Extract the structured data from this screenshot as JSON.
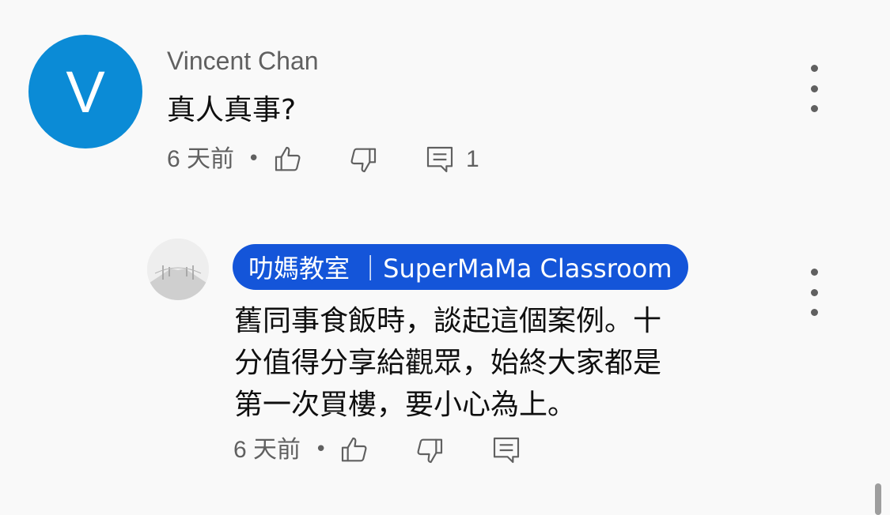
{
  "comment": {
    "author": "Vincent Chan",
    "avatar_letter": "V",
    "text": "真人真事?",
    "time": "6 天前",
    "separator": "•",
    "reply_count": "1",
    "icons": [
      "like-icon",
      "dislike-icon",
      "reply-icon",
      "more-options-icon"
    ]
  },
  "reply": {
    "author": "叻媽教室 ｜SuperMaMa Classroom",
    "text": "舊同事食飯時，談起這個案例。十\n分值得分享給觀眾，始終大家都是\n第一次買樓，要小心為上。",
    "time": "6 天前",
    "separator": "•",
    "icons": [
      "like-icon",
      "dislike-icon",
      "reply-icon",
      "more-options-icon"
    ]
  },
  "colors": {
    "avatar_bg": "#0b8bd6",
    "badge_bg": "#1455d9",
    "meta_text": "#606060",
    "background": "#f9f9f9"
  }
}
